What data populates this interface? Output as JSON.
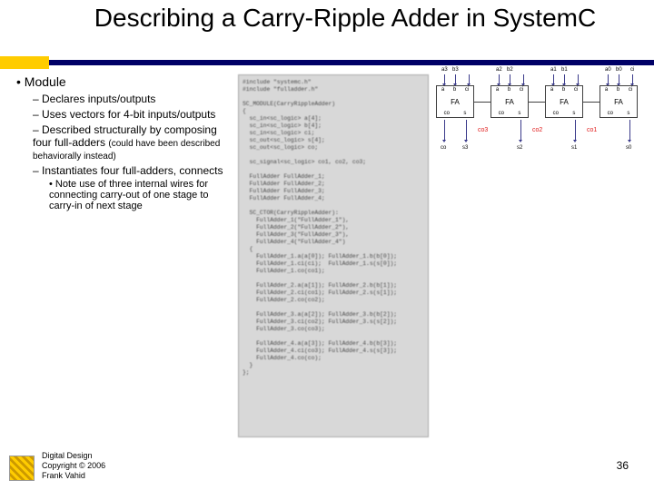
{
  "title": "Describing a Carry-Ripple Adder in SystemC",
  "bullets": {
    "b1": "Module",
    "b2a": "Declares inputs/outputs",
    "b2b": "Uses vectors for 4-bit inputs/outputs",
    "b2c_part1": "Described structurally by composing four full-adders",
    "b2c_part2": "(could have been described behaviorally instead)",
    "b2d": "Instantiates four full-adders, connects",
    "b3a": "Note use of three internal wires for connecting carry-out of one stage to carry-in of next stage"
  },
  "code_placeholder": "#include \"systemc.h\"\n#include \"fulladder.h\"\n\nSC_MODULE(CarryRippleAdder)\n{\n  sc_in<sc_logic> a[4];\n  sc_in<sc_logic> b[4];\n  sc_in<sc_logic> ci;\n  sc_out<sc_logic> s[4];\n  sc_out<sc_logic> co;\n\n  sc_signal<sc_logic> co1, co2, co3;\n\n  FullAdder FullAdder_1;\n  FullAdder FullAdder_2;\n  FullAdder FullAdder_3;\n  FullAdder FullAdder_4;\n\n  SC_CTOR(CarryRippleAdder):\n    FullAdder_1(\"FullAdder_1\"),\n    FullAdder_2(\"FullAdder_2\"),\n    FullAdder_3(\"FullAdder_3\"),\n    FullAdder_4(\"FullAdder_4\")\n  {\n    FullAdder_1.a(a[0]); FullAdder_1.b(b[0]);\n    FullAdder_1.ci(ci);  FullAdder_1.s(s[0]);\n    FullAdder_1.co(co1);\n\n    FullAdder_2.a(a[1]); FullAdder_2.b(b[1]);\n    FullAdder_2.ci(co1); FullAdder_2.s(s[1]);\n    FullAdder_2.co(co2);\n\n    FullAdder_3.a(a[2]); FullAdder_3.b(b[2]);\n    FullAdder_3.ci(co2); FullAdder_3.s(s[2]);\n    FullAdder_3.co(co3);\n\n    FullAdder_4.a(a[3]); FullAdder_4.b(b[3]);\n    FullAdder_4.ci(co3); FullAdder_4.s(s[3]);\n    FullAdder_4.co(co);\n  }\n};",
  "fa": {
    "ports_top": [
      "a",
      "b",
      "ci"
    ],
    "label": "FA",
    "ports_bot": [
      "co",
      "s"
    ]
  },
  "top_labels": [
    "a3",
    "b3",
    "a2",
    "b2",
    "a1",
    "b1",
    "a0",
    "b0",
    "ci"
  ],
  "bot_labels": {
    "co": "co",
    "s3": "s3",
    "s2": "s2",
    "s1": "s1",
    "s0": "s0"
  },
  "mid_labels": [
    "co3",
    "co2",
    "co1"
  ],
  "footer": {
    "l1": "Digital Design",
    "l2": "Copyright © 2006",
    "l3": "Frank Vahid"
  },
  "page": "36"
}
